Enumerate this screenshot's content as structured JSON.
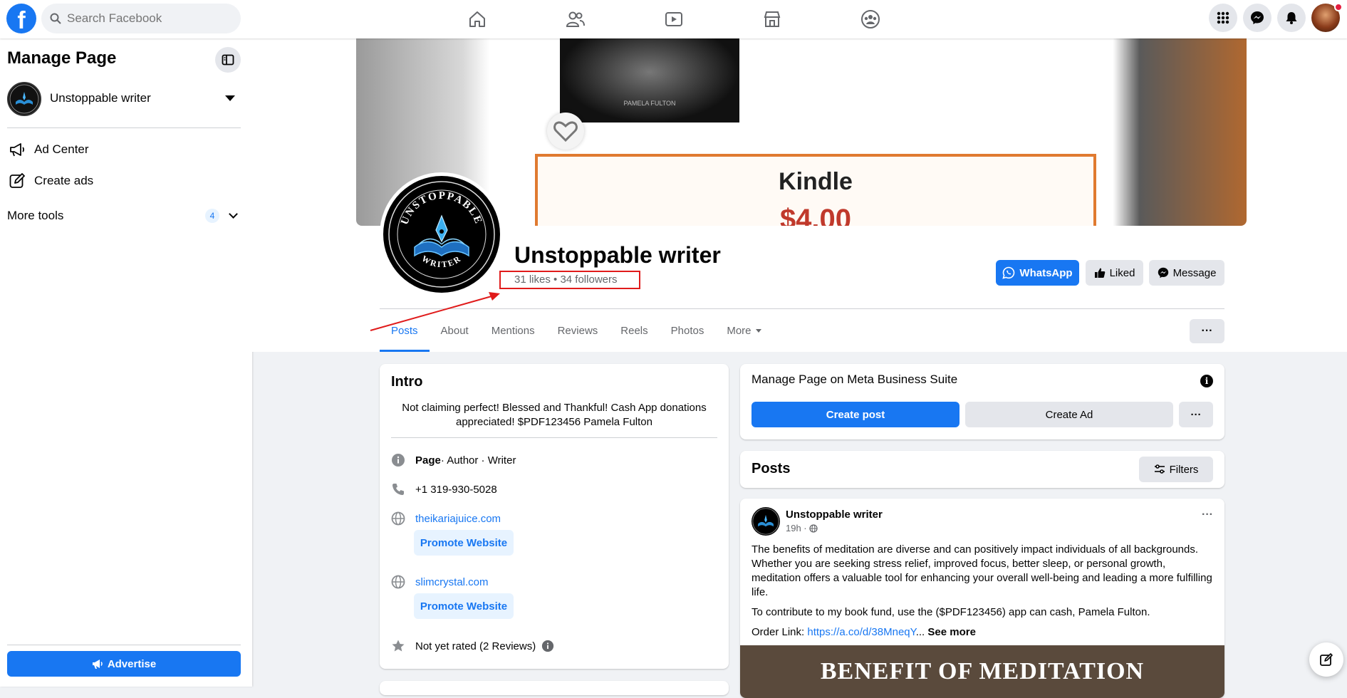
{
  "topbar": {
    "logo": "f",
    "search_placeholder": "Search Facebook",
    "nav_icons": [
      "home-icon",
      "friends-icon",
      "watch-icon",
      "marketplace-icon",
      "groups-icon"
    ],
    "right_icons": [
      "menu-grid-icon",
      "messenger-icon",
      "bell-icon",
      "profile-avatar"
    ]
  },
  "sidebar": {
    "title": "Manage Page",
    "page_name": "Unstoppable writer",
    "items": [
      {
        "label": "Ad Center",
        "icon": "megaphone-icon"
      },
      {
        "label": "Create ads",
        "icon": "edit-icon"
      }
    ],
    "more_tools": {
      "label": "More tools",
      "count": "4"
    },
    "advertise_label": "Advertise"
  },
  "cover": {
    "book_caption": "PAMELA FULTON",
    "box_title": "Kindle",
    "box_price": "$4.00"
  },
  "avatar": {
    "top_text": "UNSTOPPABLE",
    "bottom_text": "WRITER"
  },
  "page": {
    "title": "Unstoppable writer",
    "stats": "31 likes • 34 followers",
    "buttons": {
      "whatsapp": "WhatsApp",
      "liked": "Liked",
      "message": "Message"
    },
    "tabs": [
      "Posts",
      "About",
      "Mentions",
      "Reviews",
      "Reels",
      "Photos",
      "More"
    ],
    "more_menu_label": "···"
  },
  "intro": {
    "title": "Intro",
    "bio": "Not claiming perfect! Blessed and Thankful! Cash App donations appreciated! $PDF123456 Pamela Fulton",
    "category_bold": "Page",
    "category_rest": " · Author · Writer",
    "phone": "+1 319-930-5028",
    "website1": "theikariajuice.com",
    "website2": "slimcrystal.com",
    "promote_label": "Promote Website",
    "rating": "Not yet rated (2 Reviews)"
  },
  "suite": {
    "title": "Manage Page on Meta Business Suite",
    "create_post": "Create post",
    "create_ad": "Create Ad",
    "more_label": "···"
  },
  "posts": {
    "title": "Posts",
    "filters_label": "Filters"
  },
  "post": {
    "author": "Unstoppable writer",
    "time": "19h ·",
    "paragraph1": "The benefits of meditation are diverse and can positively impact individuals of all backgrounds. Whether you are seeking stress relief, improved focus, better sleep, or personal growth, meditation offers a valuable tool for enhancing your overall well-being and leading a more fulfilling life.",
    "paragraph2": "To contribute to my book fund, use the ($PDF123456) app can cash, Pamela Fulton.",
    "order_prefix": "Order Link: ",
    "order_link": "https://a.co/d/38MneqY",
    "ellipsis": "...",
    "see_more": "See more",
    "image_text": "BENEFIT OF MEDITATION"
  },
  "colors": {
    "accent": "#1877f2",
    "annotation": "#e01b1b"
  }
}
